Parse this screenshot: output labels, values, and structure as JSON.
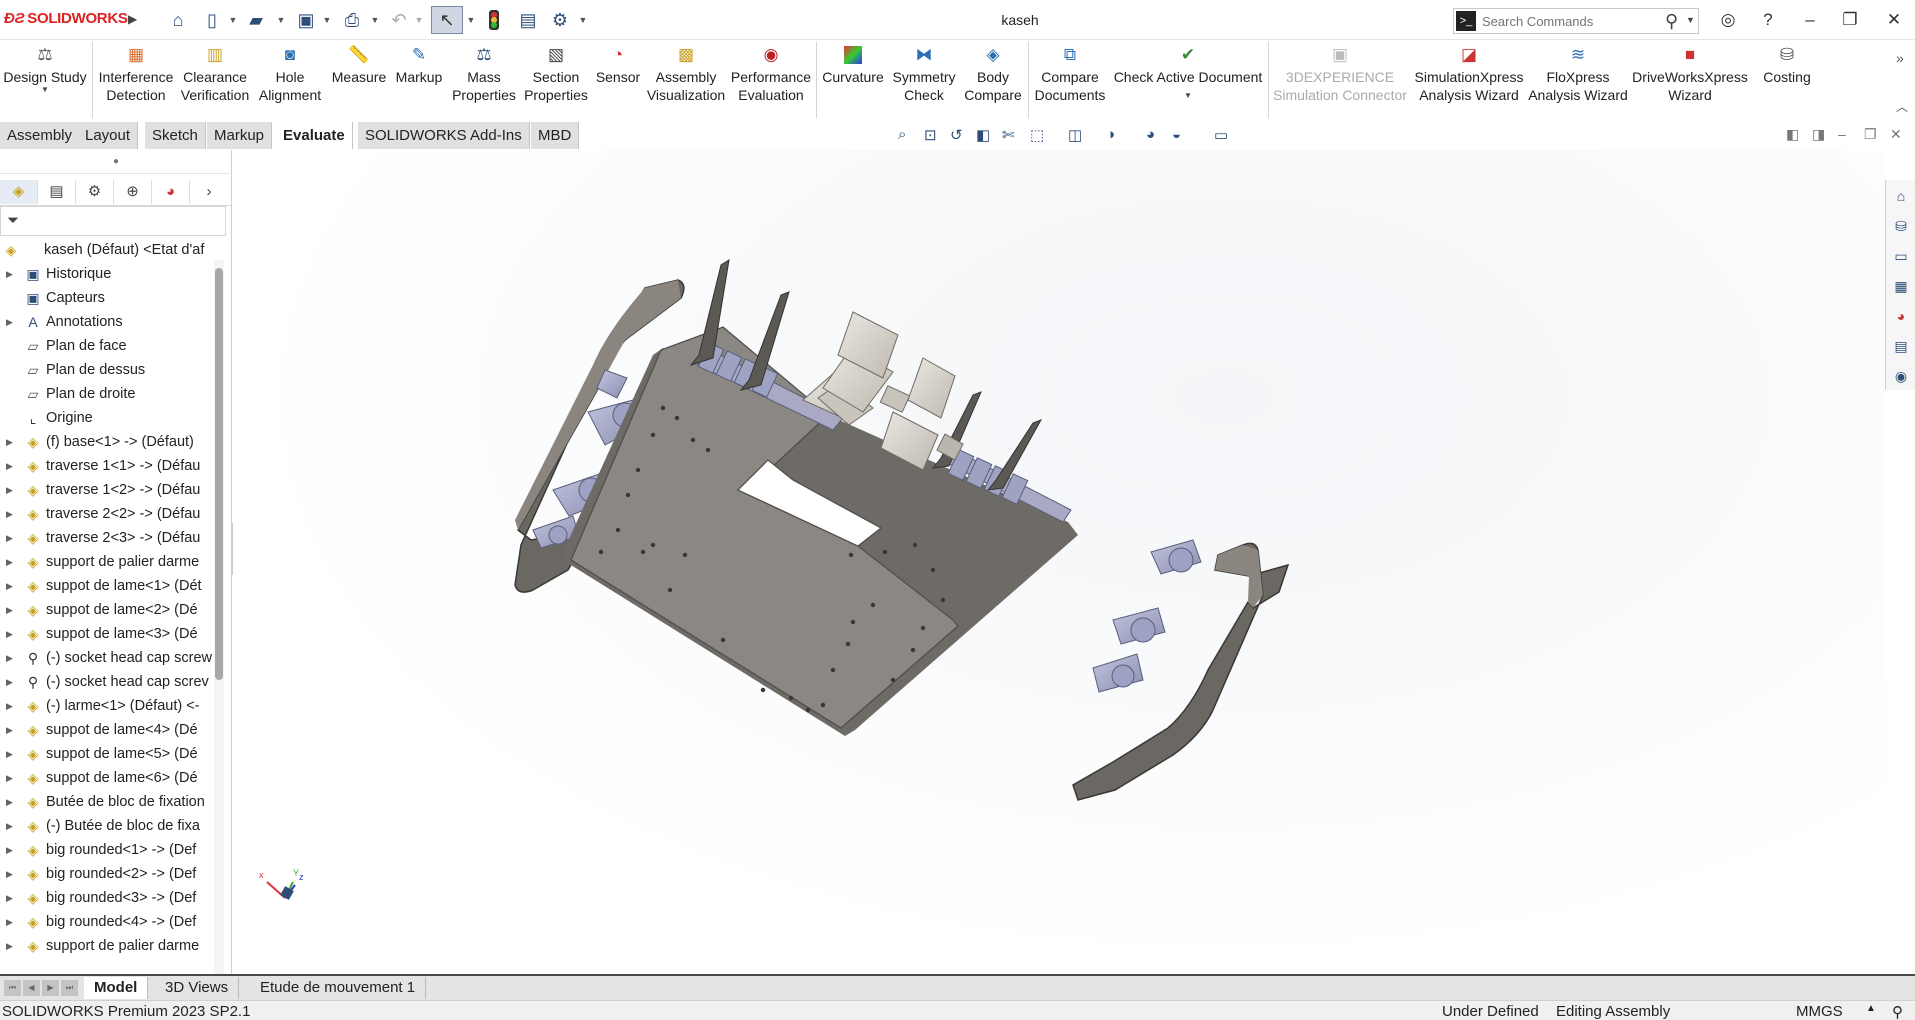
{
  "app": {
    "brand": "SOLIDWORKS",
    "document_title": "kaseh"
  },
  "search": {
    "placeholder": "Search Commands"
  },
  "ribbon": [
    {
      "label": "Design Study",
      "icon": "design-study-icon"
    },
    {
      "label": "Interference Detection",
      "icon": "interference-icon"
    },
    {
      "label": "Clearance Verification",
      "icon": "clearance-icon"
    },
    {
      "label": "Hole Alignment",
      "icon": "hole-alignment-icon"
    },
    {
      "label": "Measure",
      "icon": "measure-icon"
    },
    {
      "label": "Markup",
      "icon": "markup-icon"
    },
    {
      "label": "Mass Properties",
      "icon": "mass-properties-icon"
    },
    {
      "label": "Section Properties",
      "icon": "section-properties-icon"
    },
    {
      "label": "Sensor",
      "icon": "sensor-icon"
    },
    {
      "label": "Assembly Visualization",
      "icon": "assembly-visualization-icon"
    },
    {
      "label": "Performance Evaluation",
      "icon": "performance-icon"
    },
    {
      "label": "Curvature",
      "icon": "curvature-icon"
    },
    {
      "label": "Symmetry Check",
      "icon": "symmetry-icon"
    },
    {
      "label": "Body Compare",
      "icon": "body-compare-icon"
    },
    {
      "label": "Compare Documents",
      "icon": "compare-documents-icon"
    },
    {
      "label": "Check Active Document",
      "icon": "check-document-icon"
    },
    {
      "label": "3DEXPERIENCE Simulation Connector",
      "icon": "simulation-connector-icon",
      "disabled": true
    },
    {
      "label": "SimulationXpress Analysis Wizard",
      "icon": "simulationxpress-icon"
    },
    {
      "label": "FloXpress Analysis Wizard",
      "icon": "floxpress-icon"
    },
    {
      "label": "DriveWorksXpress Wizard",
      "icon": "driveworks-icon"
    },
    {
      "label": "Costing",
      "icon": "costing-icon"
    }
  ],
  "command_tabs": [
    "Assembly",
    "Layout",
    "Sketch",
    "Markup",
    "Evaluate",
    "SOLIDWORKS Add-Ins",
    "MBD"
  ],
  "active_command_tab": "Evaluate",
  "feature_tree": {
    "root": "kaseh (Défaut) <Etat d'af",
    "items": [
      {
        "label": "Historique",
        "icon": "history-icon",
        "expandable": true
      },
      {
        "label": "Capteurs",
        "icon": "sensor-icon",
        "expandable": false
      },
      {
        "label": "Annotations",
        "icon": "annotations-icon",
        "expandable": true
      },
      {
        "label": "Plan de face",
        "icon": "plane-icon",
        "expandable": false
      },
      {
        "label": "Plan de dessus",
        "icon": "plane-icon",
        "expandable": false
      },
      {
        "label": "Plan de droite",
        "icon": "plane-icon",
        "expandable": false
      },
      {
        "label": "Origine",
        "icon": "origin-icon",
        "expandable": false
      },
      {
        "label": "(f) base<1> -> (Défaut)",
        "icon": "part-icon",
        "expandable": true
      },
      {
        "label": "traverse 1<1> -> (Défau",
        "icon": "part-icon",
        "expandable": true
      },
      {
        "label": "traverse 1<2> -> (Défau",
        "icon": "part-icon",
        "expandable": true
      },
      {
        "label": "traverse 2<2> -> (Défau",
        "icon": "part-icon",
        "expandable": true
      },
      {
        "label": "traverse 2<3> -> (Défau",
        "icon": "part-icon",
        "expandable": true
      },
      {
        "label": "support de palier darme",
        "icon": "part-icon",
        "expandable": true
      },
      {
        "label": "suppot de lame<1> (Dét",
        "icon": "part-icon",
        "expandable": true
      },
      {
        "label": "suppot de lame<2> (Dé",
        "icon": "part-icon",
        "expandable": true
      },
      {
        "label": "suppot de lame<3> (Dé",
        "icon": "part-icon",
        "expandable": true
      },
      {
        "label": "(-) socket head cap screw",
        "icon": "screw-icon",
        "expandable": true
      },
      {
        "label": "(-) socket head cap screv",
        "icon": "screw-icon",
        "expandable": true
      },
      {
        "label": "(-) larme<1> (Défaut) <-",
        "icon": "part-icon",
        "expandable": true
      },
      {
        "label": "suppot de lame<4> (Dé",
        "icon": "part-icon",
        "expandable": true
      },
      {
        "label": "suppot de lame<5> (Dé",
        "icon": "part-icon",
        "expandable": true
      },
      {
        "label": "suppot de lame<6> (Dé",
        "icon": "part-icon",
        "expandable": true
      },
      {
        "label": "Butée de bloc de fixation",
        "icon": "part-icon",
        "expandable": true
      },
      {
        "label": "(-) Butée de bloc de fixa",
        "icon": "part-icon",
        "expandable": true
      },
      {
        "label": "big rounded<1> -> (Def",
        "icon": "part-icon",
        "expandable": true
      },
      {
        "label": "big rounded<2> -> (Def",
        "icon": "part-icon",
        "expandable": true
      },
      {
        "label": "big rounded<3> -> (Def",
        "icon": "part-icon",
        "expandable": true
      },
      {
        "label": "big rounded<4> -> (Def",
        "icon": "part-icon",
        "expandable": true
      },
      {
        "label": "support de palier darme",
        "icon": "part-icon",
        "expandable": true
      }
    ]
  },
  "bottom_tabs": [
    "Model",
    "3D Views",
    "Etude de mouvement 1"
  ],
  "active_bottom_tab": "Model",
  "status": {
    "product": "SOLIDWORKS Premium 2023 SP2.1",
    "definition": "Under Defined",
    "mode": "Editing Assembly",
    "units": "MMGS"
  },
  "colors": {
    "brand_red": "#d22222",
    "plate": "#8b8782",
    "plate_edge": "#6a6661",
    "bracket": "#a2a6c6",
    "motor": "#d9d5cd",
    "ribbon_icon_blue": "#2d4e78"
  }
}
